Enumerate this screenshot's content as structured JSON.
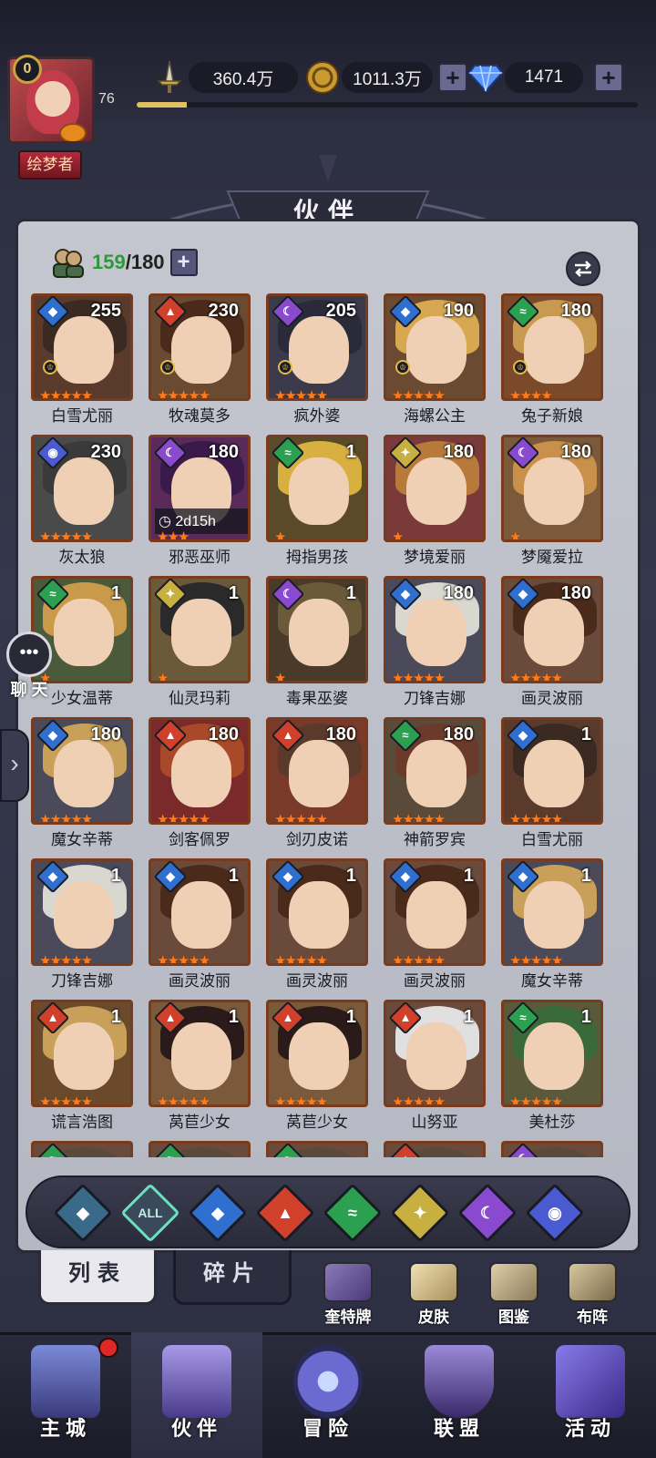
{
  "player": {
    "vip": "0",
    "level": "76",
    "exp_fraction": 0.1,
    "title": "绘梦者"
  },
  "resources": {
    "power": "360.4万",
    "gold": "1011.3万",
    "gems": "1471"
  },
  "header": {
    "title": "伙伴"
  },
  "companion_count": {
    "current": "159",
    "max": "/180"
  },
  "element_colors": {
    "water": "#2f6fd0",
    "fire": "#d0402a",
    "moon": "#8a4ad0",
    "wind": "#2aa050",
    "light": "#c8b040",
    "cosmos": "#4a5ad0",
    "all": "#3a4a5a"
  },
  "cards": [
    {
      "name": "白雪尤丽",
      "level": "255",
      "element": "water",
      "stars": 5,
      "crown": true,
      "hair": "#3a2a22",
      "bg": "#5a3a2a"
    },
    {
      "name": "牧魂莫多",
      "level": "230",
      "element": "fire",
      "stars": 5,
      "crown": true,
      "hair": "#4a2a1a",
      "bg": "#6a4a30"
    },
    {
      "name": "疯外婆",
      "level": "205",
      "element": "moon",
      "stars": 5,
      "crown": true,
      "hair": "#2a2a3a",
      "bg": "#3a3a4a"
    },
    {
      "name": "海螺公主",
      "level": "190",
      "element": "water",
      "stars": 5,
      "crown": true,
      "hair": "#d8a850",
      "bg": "#6a4a30"
    },
    {
      "name": "兔子新娘",
      "level": "180",
      "element": "wind",
      "stars": 4,
      "crown": true,
      "hair": "#c89a50",
      "bg": "#7a4a2a"
    },
    {
      "name": "灰太狼",
      "level": "230",
      "element": "cosmos",
      "stars": 5,
      "crown": false,
      "hair": "#3a3a3a",
      "bg": "#4a4a4a"
    },
    {
      "name": "邪恶巫师",
      "level": "180",
      "element": "moon",
      "stars": 3,
      "crown": false,
      "timer": "2d15h",
      "hair": "#3a1a4a",
      "bg": "#5a2a5a"
    },
    {
      "name": "拇指男孩",
      "level": "1",
      "element": "wind",
      "stars": 1,
      "crown": false,
      "hair": "#d8b040",
      "bg": "#5a4a2a"
    },
    {
      "name": "梦境爱丽",
      "level": "180",
      "element": "light",
      "stars": 1,
      "crown": false,
      "hair": "#b87a3a",
      "bg": "#7a3a3a"
    },
    {
      "name": "梦魇爱拉",
      "level": "180",
      "element": "moon",
      "stars": 1,
      "crown": false,
      "hair": "#c8904a",
      "bg": "#7a5a3a"
    },
    {
      "name": "少女温蒂",
      "level": "1",
      "element": "wind",
      "stars": 1,
      "crown": false,
      "hair": "#c89a4a",
      "bg": "#4a5a3a"
    },
    {
      "name": "仙灵玛莉",
      "level": "1",
      "element": "light",
      "stars": 1,
      "crown": false,
      "hair": "#2a2a2a",
      "bg": "#6a5a3a"
    },
    {
      "name": "毒果巫婆",
      "level": "1",
      "element": "moon",
      "stars": 1,
      "crown": false,
      "hair": "#6a5a3a",
      "bg": "#4a3a2a"
    },
    {
      "name": "刀锋吉娜",
      "level": "180",
      "element": "water",
      "stars": 5,
      "crown": false,
      "hair": "#d8d8d0",
      "bg": "#4a4a5a"
    },
    {
      "name": "画灵波丽",
      "level": "180",
      "element": "water",
      "stars": 5,
      "crown": false,
      "hair": "#4a2a1a",
      "bg": "#6a4a3a"
    },
    {
      "name": "魔女辛蒂",
      "level": "180",
      "element": "water",
      "stars": 5,
      "crown": false,
      "hair": "#c8a05a",
      "bg": "#4a4a5a"
    },
    {
      "name": "剑客佩罗",
      "level": "180",
      "element": "fire",
      "stars": 5,
      "crown": false,
      "hair": "#a84a2a",
      "bg": "#7a2a2a"
    },
    {
      "name": "剑刃皮诺",
      "level": "180",
      "element": "fire",
      "stars": 5,
      "crown": false,
      "hair": "#5a3a2a",
      "bg": "#7a3a2a"
    },
    {
      "name": "神箭罗宾",
      "level": "180",
      "element": "wind",
      "stars": 5,
      "crown": false,
      "hair": "#6a3a2a",
      "bg": "#5a4a3a"
    },
    {
      "name": "白雪尤丽",
      "level": "1",
      "element": "water",
      "stars": 5,
      "crown": false,
      "hair": "#3a2a22",
      "bg": "#5a3a2a"
    },
    {
      "name": "刀锋吉娜",
      "level": "1",
      "element": "water",
      "stars": 5,
      "crown": false,
      "hair": "#d8d8d0",
      "bg": "#4a4a5a"
    },
    {
      "name": "画灵波丽",
      "level": "1",
      "element": "water",
      "stars": 5,
      "crown": false,
      "hair": "#4a2a1a",
      "bg": "#6a4a3a"
    },
    {
      "name": "画灵波丽",
      "level": "1",
      "element": "water",
      "stars": 5,
      "crown": false,
      "hair": "#4a2a1a",
      "bg": "#6a4a3a"
    },
    {
      "name": "画灵波丽",
      "level": "1",
      "element": "water",
      "stars": 5,
      "crown": false,
      "hair": "#4a2a1a",
      "bg": "#6a4a3a"
    },
    {
      "name": "魔女辛蒂",
      "level": "1",
      "element": "water",
      "stars": 5,
      "crown": false,
      "hair": "#c8a05a",
      "bg": "#4a4a5a"
    },
    {
      "name": "谎言浩图",
      "level": "1",
      "element": "fire",
      "stars": 5,
      "crown": false,
      "hair": "#c8a05a",
      "bg": "#6a4a2a"
    },
    {
      "name": "莴苣少女",
      "level": "1",
      "element": "fire",
      "stars": 5,
      "crown": false,
      "hair": "#2a1a1a",
      "bg": "#7a5a3a"
    },
    {
      "name": "莴苣少女",
      "level": "1",
      "element": "fire",
      "stars": 5,
      "crown": false,
      "hair": "#2a1a1a",
      "bg": "#7a5a3a"
    },
    {
      "name": "山努亚",
      "level": "1",
      "element": "fire",
      "stars": 5,
      "crown": false,
      "hair": "#e0e0e0",
      "bg": "#6a4a3a"
    },
    {
      "name": "美杜莎",
      "level": "1",
      "element": "wind",
      "stars": 5,
      "crown": false,
      "hair": "#3a6a3a",
      "bg": "#5a5a3a"
    },
    {
      "name": "",
      "level": "",
      "element": "wind",
      "stars": 0,
      "crown": false,
      "hair": "#5a4a3a",
      "bg": "#6a4a3a"
    },
    {
      "name": "",
      "level": "",
      "element": "wind",
      "stars": 0,
      "crown": false,
      "hair": "#5a4a3a",
      "bg": "#6a4a3a"
    },
    {
      "name": "",
      "level": "",
      "element": "wind",
      "stars": 0,
      "crown": false,
      "hair": "#5a4a3a",
      "bg": "#6a4a3a"
    },
    {
      "name": "",
      "level": "",
      "element": "fire",
      "stars": 0,
      "crown": false,
      "hair": "#5a4a3a",
      "bg": "#6a4a3a"
    },
    {
      "name": "",
      "level": "",
      "element": "moon",
      "stars": 0,
      "crown": false,
      "hair": "#5a4a3a",
      "bg": "#6a4a3a"
    }
  ],
  "filters": [
    {
      "id": "cosmos-top",
      "label": "",
      "color": "#3a6a8a"
    },
    {
      "id": "all",
      "label": "ALL",
      "color": "#3a4a5a"
    },
    {
      "id": "water",
      "label": "",
      "color": "#2f6fd0"
    },
    {
      "id": "fire",
      "label": "",
      "color": "#d0402a"
    },
    {
      "id": "wind",
      "label": "",
      "color": "#2aa050"
    },
    {
      "id": "light",
      "label": "",
      "color": "#c8b040"
    },
    {
      "id": "moon",
      "label": "",
      "color": "#8a4ad0"
    },
    {
      "id": "cosmos",
      "label": "",
      "color": "#4a5ad0"
    }
  ],
  "tabs": {
    "list": "列表",
    "shards": "碎片"
  },
  "quick": {
    "tarot": "奎特牌",
    "skins": "皮肤",
    "codex": "图鉴",
    "formation": "布阵"
  },
  "nav": {
    "city": "主城",
    "partners": "伙伴",
    "adventure": "冒险",
    "guild": "联盟",
    "events": "活动"
  },
  "chat": {
    "label": "聊 天"
  }
}
